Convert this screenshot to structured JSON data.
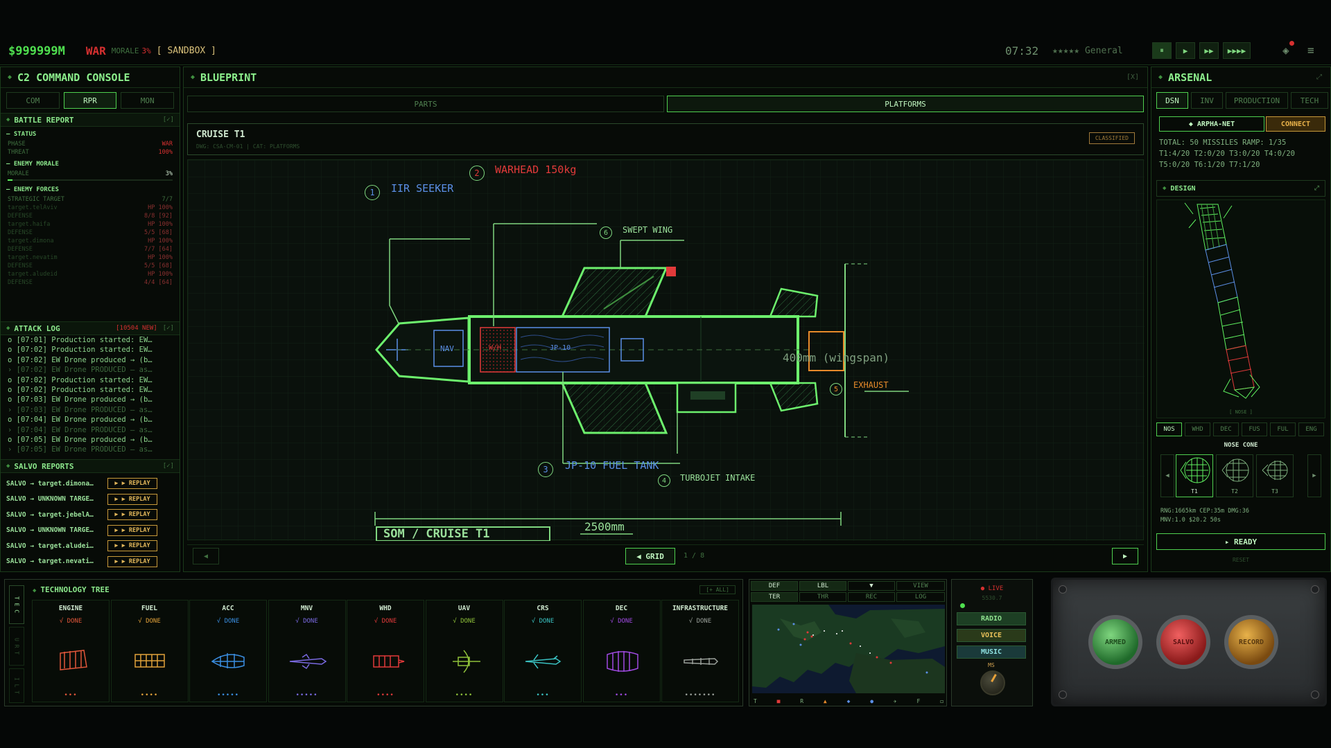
{
  "topbar": {
    "money": "$999999M",
    "war": "WAR",
    "morale_label": "MORALE",
    "morale_value": "3%",
    "mode": "[ SANDBOX ]",
    "clock": "07:32",
    "rank": "★★★★★ General",
    "speed_buttons": [
      "⏸",
      "▶",
      "▶▶",
      "▶▶▶▶"
    ]
  },
  "c2": {
    "title": "C2 COMMAND CONSOLE",
    "tabs": [
      "COM",
      "RPR",
      "MON"
    ],
    "active_tab": "RPR",
    "battle_report": {
      "title": "BATTLE REPORT",
      "status_head": "STATUS",
      "phase_label": "PHASE",
      "phase_value": "WAR",
      "threat_label": "THREAT",
      "threat_value": "100%",
      "morale_head": "ENEMY MORALE",
      "morale_label": "MORALE",
      "morale_value": "3%",
      "forces_head": "ENEMY FORCES",
      "forces": [
        {
          "label": "STRATEGIC TARGET",
          "value": "7/7"
        },
        {
          "label": "target.telAviv",
          "value": "HP 100%"
        },
        {
          "label": "DEFENSE",
          "value": "8/8 [92]"
        },
        {
          "label": "target.haifa",
          "value": "HP 100%"
        },
        {
          "label": "DEFENSE",
          "value": "5/5 [68]"
        },
        {
          "label": "target.dimona",
          "value": "HP 100%"
        },
        {
          "label": "DEFENSE",
          "value": "7/7 [64]"
        },
        {
          "label": "target.nevatim",
          "value": "HP 100%"
        },
        {
          "label": "DEFENSE",
          "value": "5/5 [68]"
        },
        {
          "label": "target.aludeid",
          "value": "HP 100%"
        },
        {
          "label": "DEFENSE",
          "value": "4/4 [64]"
        }
      ]
    },
    "attack_log": {
      "title": "ATTACK LOG",
      "badge": "[10504 NEW]",
      "lines": [
        "o [07:01] Production started: EW…",
        "o [07:02] Production started: EW…",
        "o [07:02] EW Drone produced → (b…",
        "› [07:02] EW Drone PRODUCED — as…",
        "o [07:02] Production started: EW…",
        "o [07:02] Production started: EW…",
        "o [07:03] EW Drone produced → (b…",
        "› [07:03] EW Drone PRODUCED — as…",
        "o [07:04] EW Drone produced → (b…",
        "› [07:04] EW Drone PRODUCED — as…",
        "o [07:05] EW Drone produced → (b…",
        "› [07:05] EW Drone PRODUCED — as…"
      ]
    },
    "salvo_reports": {
      "title": "SALVO REPORTS",
      "replay_label": "▶ ▶ REPLAY",
      "items": [
        "SALVO → target.dimona…",
        "SALVO → UNKNOWN TARGE…",
        "SALVO → target.jebelA…",
        "SALVO → UNKNOWN TARGE…",
        "SALVO → target.aludei…",
        "SALVO → target.nevati…"
      ]
    }
  },
  "blueprint": {
    "title": "BLUEPRINT",
    "close": "[X]",
    "tabs": [
      "PARTS",
      "PLATFORMS"
    ],
    "active_tab": "PLATFORMS",
    "name": "CRUISE T1",
    "sub": "DWG: CSA-CM-01 | CAT: PLATFORMS",
    "stamp": "CLASSIFIED",
    "labels": {
      "seeker": "IIR SEEKER",
      "warhead": "WARHEAD 150kg",
      "wing": "SWEPT WING",
      "fuel": "JP-10 FUEL TANK",
      "intake": "TURBOJET INTAKE",
      "exhaust": "EXHAUST",
      "wingspan": "400mm (wingspan)",
      "length": "2500mm",
      "nav": "NAV",
      "wh": "W/H",
      "jp": "JP-10",
      "plate": "SOM / CRUISE T1"
    },
    "numbers": [
      "1",
      "2",
      "3",
      "4",
      "5",
      "6"
    ],
    "nav": {
      "prev": "◀",
      "grid": "◀ GRID",
      "page": "1 / 8",
      "next": "▶"
    }
  },
  "arsenal": {
    "title": "ARSENAL",
    "tabs": [
      "DSN",
      "INV",
      "PRODUCTION",
      "TECH"
    ],
    "active_tab": "DSN",
    "net": "◆ ARPHA-NET",
    "connect": "CONNECT",
    "stats": [
      "TOTAL: 50 MISSILES RAMP: 1/35",
      "T1:4/20 T2:0/20 T3:0/20 T4:0/20",
      "T5:0/20 T6:1/20 T7:1/20"
    ],
    "design_title": "DESIGN",
    "view_label": "[ NOSE ]",
    "part_tabs": [
      "NOS",
      "WHD",
      "DEC",
      "FUS",
      "FUL",
      "ENG"
    ],
    "active_part": "NOS",
    "section_title": "NOSE CONE",
    "tiers": [
      "T1",
      "T2",
      "T3"
    ],
    "specs": [
      "RNG:1665km CEP:35m DMG:36",
      "MNV:1.0 $20.2 50s"
    ],
    "ready": "▸ READY",
    "reset": "RESET"
  },
  "tech_tree": {
    "title": "TECHNOLOGY TREE",
    "all": "[+ ALL]",
    "side_tabs": [
      "T E C",
      "U R T",
      "I L T"
    ],
    "columns": [
      {
        "name": "ENGINE",
        "status": "√ DONE",
        "color": "#e2563a",
        "dots": "•••"
      },
      {
        "name": "FUEL",
        "status": "√ DONE",
        "color": "#e2a23a",
        "dots": "••••"
      },
      {
        "name": "ACC",
        "status": "√ DONE",
        "color": "#3a8fe2",
        "dots": "•••••"
      },
      {
        "name": "MNV",
        "status": "√ DONE",
        "color": "#7a6ae2",
        "dots": "•••••"
      },
      {
        "name": "WHD",
        "status": "√ DONE",
        "color": "#e23a3a",
        "dots": "••••"
      },
      {
        "name": "UAV",
        "status": "√ DONE",
        "color": "#8fc23a",
        "dots": "••••"
      },
      {
        "name": "CRS",
        "status": "√ DONE",
        "color": "#3ac2c2",
        "dots": "•••"
      },
      {
        "name": "DEC",
        "status": "√ DONE",
        "color": "#a04ae2",
        "dots": "•••"
      },
      {
        "name": "INFRASTRUCTURE",
        "status": "√ DONE",
        "color": "#9aa09a",
        "dots": "•••••••"
      }
    ]
  },
  "map": {
    "tabs_top": [
      "DEF",
      "LBL",
      "▼",
      "VIEW"
    ],
    "tabs_bottom": [
      "TER",
      "THR",
      "REC",
      "LOG"
    ],
    "legend": [
      "T",
      "■",
      "R",
      "▲",
      "◆",
      "●",
      "✈",
      "F",
      "◻"
    ]
  },
  "audio": {
    "live": "● LIVE",
    "live_value": "5530.7",
    "buttons": [
      "RADIO",
      "VOICE",
      "MUSIC"
    ],
    "knob_label": "MS"
  },
  "control": {
    "buttons": [
      "ARMED",
      "SALVO",
      "RECORD"
    ]
  },
  "colors": {
    "accent": "#5ff05f",
    "alert": "#d63030",
    "warning": "#e8a23a",
    "blue": "#5b8fe6"
  }
}
